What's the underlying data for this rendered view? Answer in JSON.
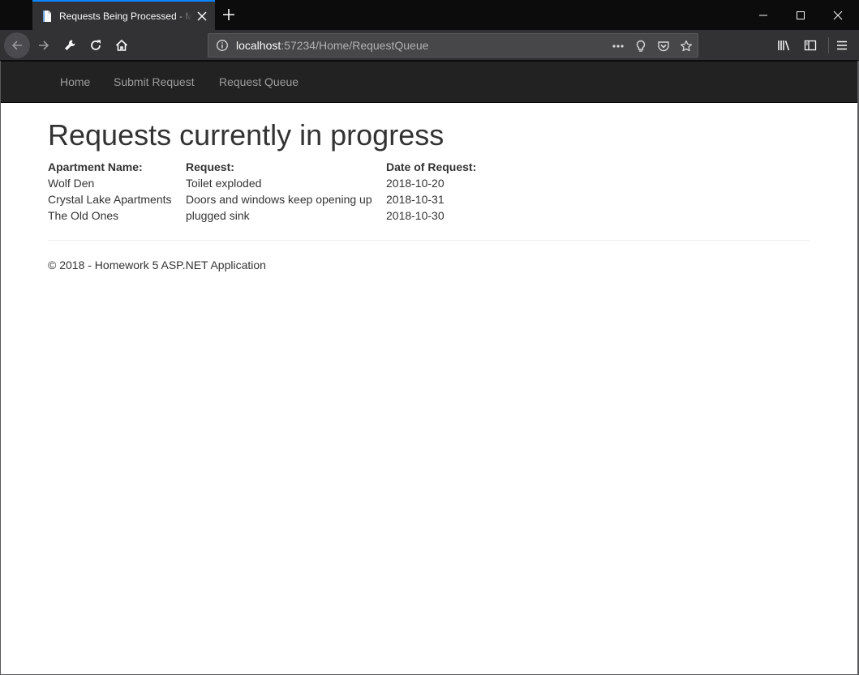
{
  "browser": {
    "tab_title": "Requests Being Processed - My ASP.NET Application",
    "url_host": "localhost",
    "url_rest": ":57234/Home/RequestQueue",
    "window_controls": [
      "minimize-icon",
      "maximize-icon",
      "close-icon"
    ],
    "toolbar_icons": [
      "back-icon",
      "forward-icon",
      "wrench-icon",
      "reload-icon",
      "home-icon",
      "info-icon",
      "more-actions-icon",
      "lightbulb-icon",
      "pocket-icon",
      "bookmark-star-icon",
      "library-icon",
      "sidebar-icon",
      "hamburger-menu-icon"
    ],
    "accent_color": "#0a84ff"
  },
  "site_nav": {
    "items": [
      {
        "label": "Home"
      },
      {
        "label": "Submit Request"
      },
      {
        "label": "Request Queue"
      }
    ]
  },
  "page": {
    "title": "Requests currently in progress",
    "table": {
      "headers": [
        "Apartment Name:",
        "Request:",
        "Date of Request:"
      ],
      "rows": [
        [
          "Wolf Den",
          "Toilet exploded",
          "2018-10-20"
        ],
        [
          "Crystal Lake Apartments",
          "Doors and windows keep opening up",
          "2018-10-31"
        ],
        [
          "The Old Ones",
          "plugged sink",
          "2018-10-30"
        ]
      ]
    },
    "footer": "© 2018 - Homework 5 ASP.NET Application"
  }
}
